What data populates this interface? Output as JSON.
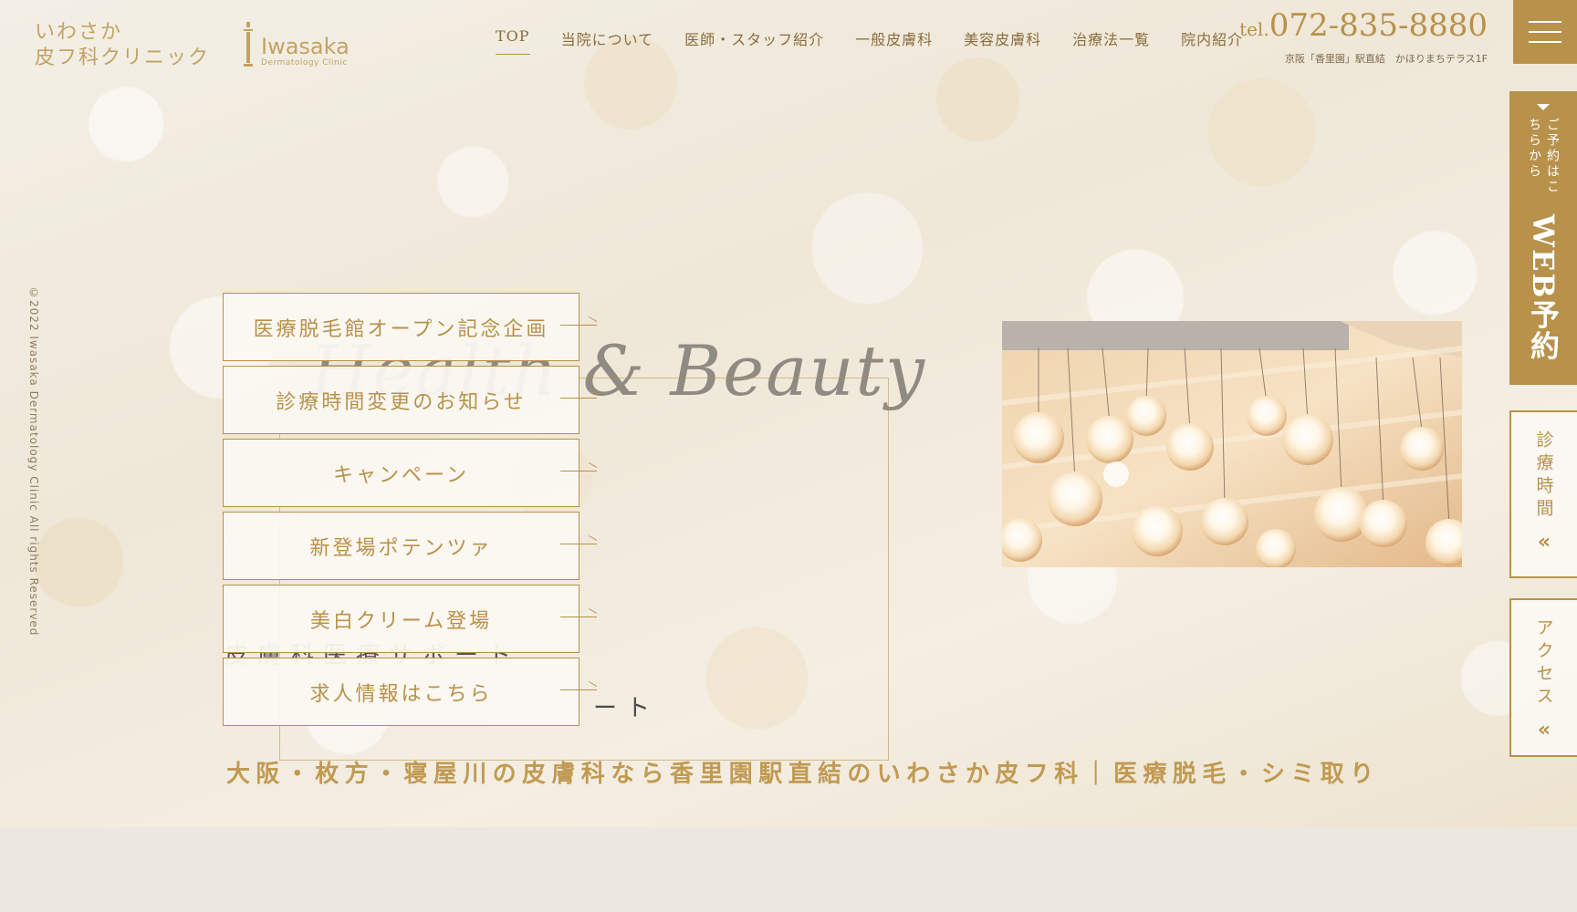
{
  "header": {
    "logo_jp_line1": "いわさか",
    "logo_jp_line2": "皮フ科クリニック",
    "logo_en": "Iwasaka",
    "logo_en_sub": "Dermatology Clinic",
    "nav": [
      "TOP",
      "当院について",
      "医師・スタッフ紹介",
      "一般皮膚科",
      "美容皮膚科",
      "治療法一覧",
      "院内紹介"
    ],
    "tel_prefix": "tel.",
    "tel_number": "072-835-8880",
    "address": "京阪「香里園」駅直結　かほりまちテラス1F"
  },
  "copyright": "©2022 Iwasaka Dermatology Clinic All rights Reserved",
  "hero": {
    "script_text": "Health & Beauty",
    "partial_line": "皮膚科医療サポート",
    "partial_line2": "ート",
    "notices": [
      "医療脱毛館オープン記念企画",
      "診療時間変更のお知らせ",
      "キャンペーン",
      "新登場ポテンツァ",
      "美白クリーム登場",
      "求人情報はこちら"
    ],
    "tagline": "大阪・枚方・寝屋川の皮膚科なら香里園駅直結のいわさか皮フ科｜医療脱毛・シミ取り"
  },
  "side": {
    "web_small": "ご予約はこちらから",
    "web_big": "WEB予約",
    "hours": "診療時間",
    "access": "アクセス",
    "chevron": "«"
  },
  "colors": {
    "gold": "#b8914a",
    "cream": "#f3efe6"
  }
}
